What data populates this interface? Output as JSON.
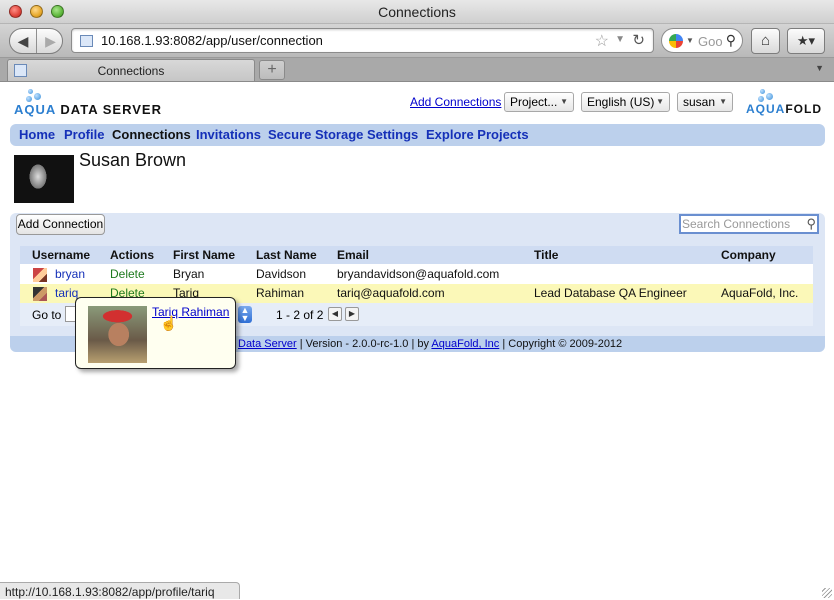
{
  "window": {
    "title": "Connections"
  },
  "toolbar": {
    "back_icon": "back-arrow-icon",
    "forward_icon": "forward-arrow-icon",
    "url": "10.168.1.93:8082/app/user/connection",
    "search_placeholder": "Goo",
    "home_icon": "home-icon",
    "bookmark_icon": "bookmark-icon"
  },
  "tabs": [
    {
      "label": "Connections"
    }
  ],
  "header": {
    "logo_left": {
      "prefix": "AQUA",
      "suffix": "DATA SERVER"
    },
    "logo_right": {
      "prefix": "AQUA",
      "suffix": "FOLD"
    },
    "add_connections_link": "Add Connections",
    "project_select": "Project...",
    "language_select": "English (US)",
    "user_select": "susan"
  },
  "nav": [
    {
      "label": "Home"
    },
    {
      "label": "Profile"
    },
    {
      "label": "Connections"
    },
    {
      "label": "Invitations"
    },
    {
      "label": "Secure Storage"
    },
    {
      "label": "Settings"
    },
    {
      "label": "Explore Projects"
    }
  ],
  "profile": {
    "name": "Susan Brown"
  },
  "connections": {
    "add_button": "Add Connection",
    "search_placeholder": "Search Connections",
    "columns": [
      "Username",
      "Actions",
      "First Name",
      "Last Name",
      "Email",
      "Title",
      "Company"
    ],
    "rows": [
      {
        "username": "bryan",
        "action": "Delete",
        "first": "Bryan",
        "last": "Davidson",
        "email": "bryandavidson@aquafold.com",
        "title": "",
        "company": ""
      },
      {
        "username": "tariq",
        "action": "Delete",
        "first": "Tariq",
        "last": "Rahiman",
        "email": "tariq@aquafold.com",
        "title": "Lead Database QA Engineer",
        "company": "AquaFold, Inc."
      }
    ],
    "pager": {
      "goto_label": "Go to",
      "page_info": "1 - 2 of 2"
    }
  },
  "footer": {
    "link1": "Data Server",
    "version": " | Version - 2.0.0-rc-1.0 | by ",
    "link2": "AquaFold, Inc",
    "copyright": " | Copyright © 2009-2012"
  },
  "popup": {
    "name": "Tariq Rahiman"
  },
  "status": {
    "url": "http://10.168.1.93:8082/app/profile/tariq"
  },
  "colors": {
    "nav_bg": "#bcd0ec",
    "panel_bg": "#dde6f5",
    "highlight_row": "#fbf8b8",
    "link": "#1530b8"
  }
}
